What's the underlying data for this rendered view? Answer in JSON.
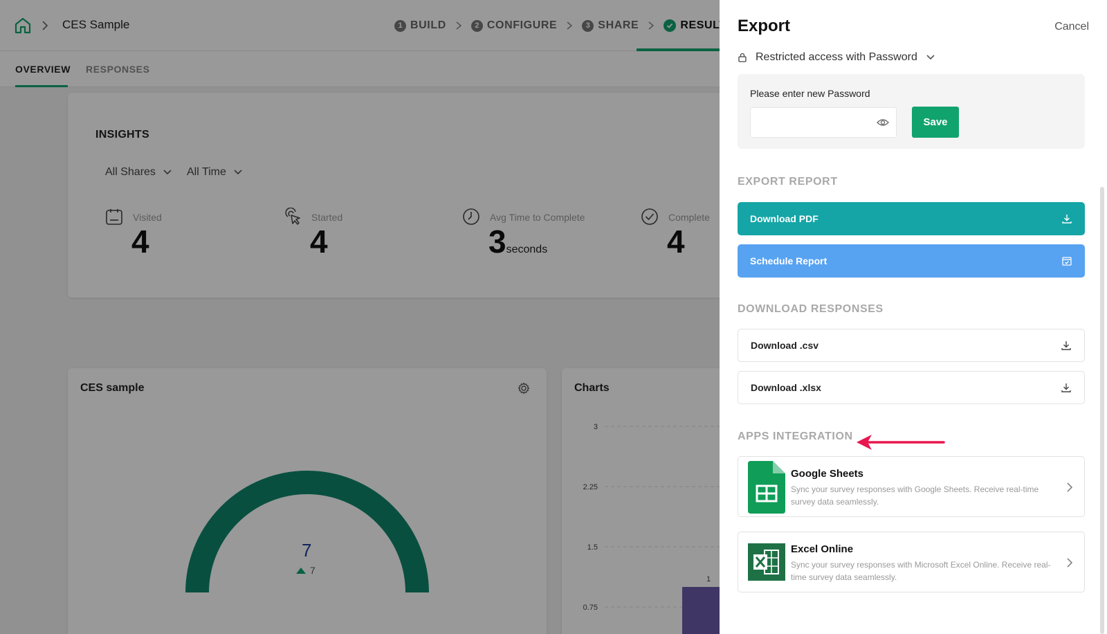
{
  "header": {
    "breadcrumb_title": "CES Sample",
    "steps": [
      {
        "num": "1",
        "label": "BUILD"
      },
      {
        "num": "2",
        "label": "CONFIGURE"
      },
      {
        "num": "3",
        "label": "SHARE"
      },
      {
        "num": "",
        "label": "RESULTS"
      }
    ]
  },
  "subtabs": {
    "overview": "OVERVIEW",
    "responses": "RESPONSES"
  },
  "insights": {
    "title": "INSIGHTS",
    "filter_shares": "All Shares",
    "filter_time": "All Time",
    "metrics": [
      {
        "label": "Visited",
        "value": "4",
        "unit": ""
      },
      {
        "label": "Started",
        "value": "4",
        "unit": ""
      },
      {
        "label": "Avg Time to Complete",
        "value": "3",
        "unit": "seconds"
      },
      {
        "label": "Complete",
        "value": "4",
        "unit": ""
      }
    ]
  },
  "ces_card": {
    "title": "CES sample",
    "score": "7",
    "delta": "7",
    "gauge_color": "#10846b"
  },
  "charts_card": {
    "title": "Charts",
    "chart_data": {
      "type": "bar",
      "yticks": [
        "3",
        "2.25",
        "1.5",
        "0.75"
      ],
      "ylim": [
        0,
        3
      ],
      "values": [
        1
      ],
      "data_labels": [
        "1"
      ],
      "bar_color": "#6b5ba8"
    }
  },
  "panel": {
    "title": "Export",
    "cancel": "Cancel",
    "access_label": "Restricted access with Password",
    "password_label": "Please enter new Password",
    "password_value": "",
    "save_label": "Save",
    "export_report_title": "EXPORT REPORT",
    "download_pdf": "Download PDF",
    "schedule_report": "Schedule Report",
    "download_responses_title": "DOWNLOAD RESPONSES",
    "download_csv": "Download .csv",
    "download_xlsx": "Download .xlsx",
    "apps_title": "APPS INTEGRATION",
    "apps": [
      {
        "name": "Google Sheets",
        "desc": "Sync your survey responses with Google Sheets. Receive real-time survey data seamlessly."
      },
      {
        "name": "Excel Online",
        "desc": "Sync your survey responses with Microsoft Excel Online. Receive real-time survey data seamlessly."
      }
    ]
  },
  "colors": {
    "accent_green": "#11a36e",
    "pdf_teal": "#15a5a6",
    "schedule_blue": "#57a3f1",
    "arrow_red": "#e8174f"
  }
}
